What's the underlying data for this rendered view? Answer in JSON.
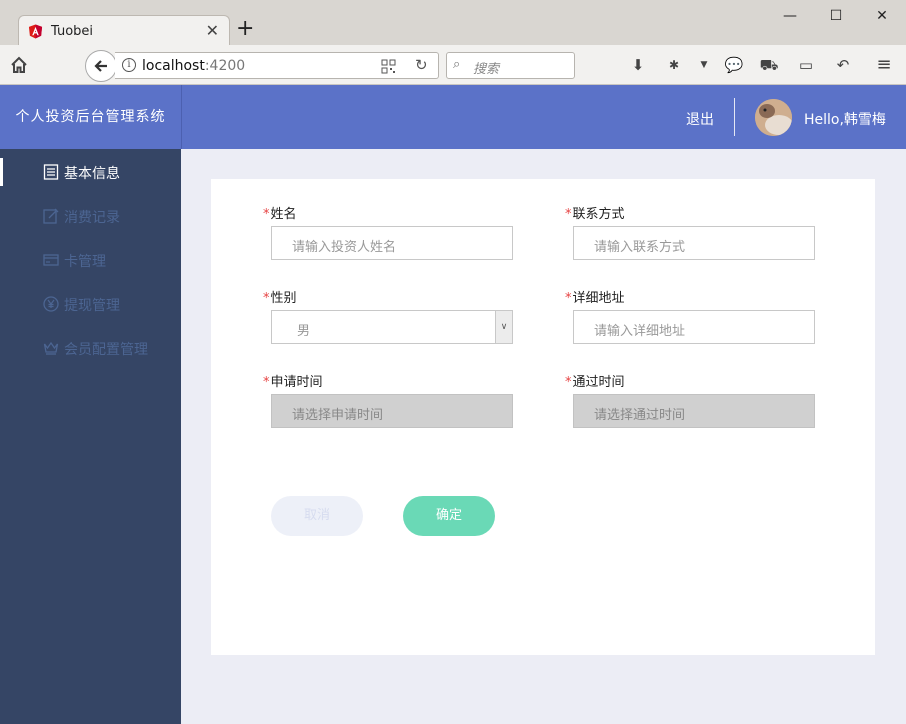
{
  "browser": {
    "tab_title": "Tuobei",
    "url_host": "localhost",
    "url_port": ":4200",
    "search_placeholder": "搜索"
  },
  "app": {
    "system_title": "个人投资后台管理系统",
    "logout_label": "退出",
    "greeting": "Hello,韩雪梅"
  },
  "sidebar": {
    "items": [
      {
        "label": "基本信息",
        "icon": "document-icon",
        "active": true
      },
      {
        "label": "消费记录",
        "icon": "edit-icon",
        "active": false
      },
      {
        "label": "卡管理",
        "icon": "card-icon",
        "active": false
      },
      {
        "label": "提现管理",
        "icon": "yen-icon",
        "active": false
      },
      {
        "label": "会员配置管理",
        "icon": "crown-icon",
        "active": false
      }
    ]
  },
  "form": {
    "name": {
      "label": "姓名",
      "placeholder": "请输入投资人姓名"
    },
    "contact": {
      "label": "联系方式",
      "placeholder": "请输入联系方式"
    },
    "gender": {
      "label": "性别",
      "value": "男"
    },
    "address": {
      "label": "详细地址",
      "placeholder": "请输入详细地址"
    },
    "apply_time": {
      "label": "申请时间",
      "placeholder": "请选择申请时间"
    },
    "pass_time": {
      "label": "通过时间",
      "placeholder": "请选择通过时间"
    },
    "required_mark": "*",
    "cancel_label": "取消",
    "confirm_label": "确定"
  },
  "colors": {
    "header": "#5b72c8",
    "sidebar": "#354565",
    "confirm": "#6ad9b6",
    "required": "#e64242"
  }
}
